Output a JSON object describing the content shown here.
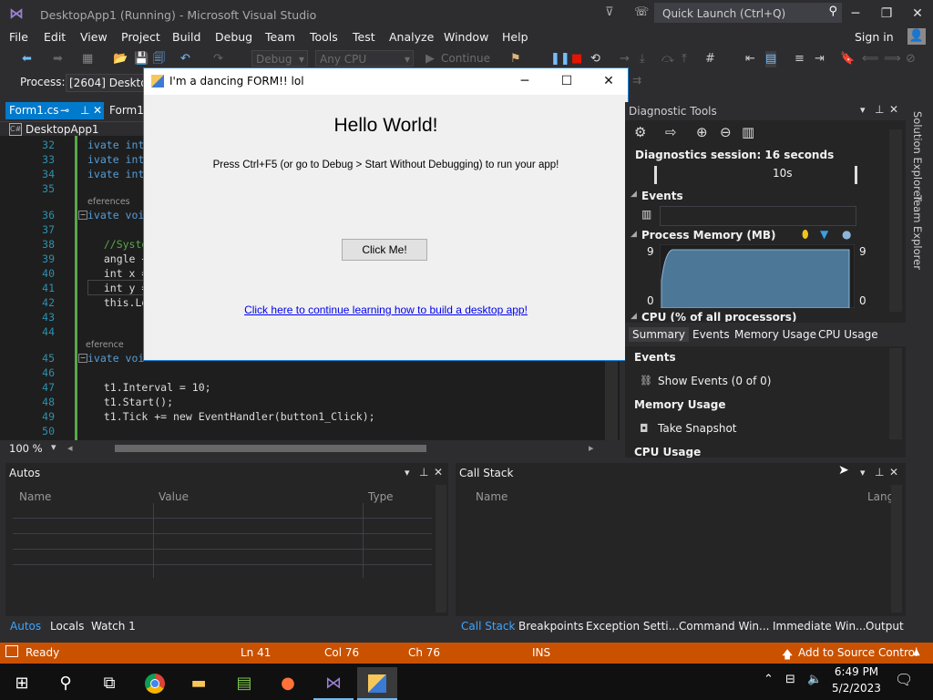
{
  "window": {
    "title": "DesktopApp1 (Running) - Microsoft Visual Studio",
    "quick_launch_placeholder": "Quick Launch (Ctrl+Q)",
    "minimize": "─",
    "maximize": "❐",
    "close": "✕"
  },
  "menu": [
    "File",
    "Edit",
    "View",
    "Project",
    "Build",
    "Debug",
    "Team",
    "Tools",
    "Test",
    "Analyze",
    "Window",
    "Help"
  ],
  "signin": "Sign in",
  "toolbar": {
    "config": "Debug",
    "platform": "Any CPU",
    "continue": "Continue"
  },
  "process": {
    "label": "Process:",
    "value": "[2604] Desktop"
  },
  "doctabs": [
    {
      "label": "Form1.cs"
    },
    {
      "label": "Form1."
    }
  ],
  "breadcrumb": "DesktopApp1",
  "code_lines": [
    {
      "n": "32",
      "text": "ivate int"
    },
    {
      "n": "33",
      "text": "ivate int"
    },
    {
      "n": "34",
      "text": "ivate int"
    },
    {
      "n": "35",
      "text": ""
    },
    {
      "n": "36",
      "text": "ivate voi"
    },
    {
      "n": "37",
      "text": ""
    },
    {
      "n": "38",
      "text": "  //Syste"
    },
    {
      "n": "39",
      "text": "  angle +"
    },
    {
      "n": "40",
      "text": "  int x ="
    },
    {
      "n": "41",
      "text": "  int y ="
    },
    {
      "n": "42",
      "text": "  this.Lo"
    },
    {
      "n": "43",
      "text": ""
    },
    {
      "n": "44",
      "text": ""
    },
    {
      "n": "45",
      "text": "ivate voi"
    },
    {
      "n": "46",
      "text": ""
    },
    {
      "n": "47",
      "text": "  t1.Interval = 10;"
    },
    {
      "n": "48",
      "text": "  t1.Start();"
    },
    {
      "n": "49",
      "text": "  t1.Tick += new EventHandler(button1_Click);"
    },
    {
      "n": "50",
      "text": ""
    }
  ],
  "refs": [
    "eferences",
    "eference"
  ],
  "zoom": "100 %",
  "dialog": {
    "title": "I'm a dancing FORM!! lol",
    "heading": "Hello World!",
    "instructions": "Press Ctrl+F5 (or go to Debug > Start Without Debugging) to run your app!",
    "button": "Click Me!",
    "link": "Click here to continue learning how to build a desktop app!"
  },
  "diagnostic": {
    "title": "Diagnostic Tools",
    "session": "Diagnostics session: 16 seconds",
    "tick": "10s",
    "events_header": "Events",
    "memory_header": "Process Memory (MB)",
    "mem_max_left": "9",
    "mem_min_left": "0",
    "mem_max_right": "9",
    "mem_min_right": "0",
    "cpu_header": "CPU (% of all processors)",
    "tabs": [
      "Summary",
      "Events",
      "Memory Usage",
      "CPU Usage"
    ],
    "events_section": "Events",
    "show_events": "Show Events (0 of 0)",
    "memory_section": "Memory Usage",
    "snapshot": "Take Snapshot",
    "cpu_section": "CPU Usage"
  },
  "side_labels": [
    "Solution Explorer",
    "Team Explorer"
  ],
  "autos": {
    "title": "Autos",
    "cols": [
      "Name",
      "Value",
      "Type"
    ]
  },
  "callstack": {
    "title": "Call Stack",
    "cols": [
      "Name",
      "Lang"
    ]
  },
  "bottom_tabs_left": [
    "Autos",
    "Locals",
    "Watch 1"
  ],
  "bottom_tabs_right": [
    "Call Stack",
    "Breakpoints",
    "Exception Setti...",
    "Command Win...",
    "Immediate Win...",
    "Output"
  ],
  "status": {
    "ready": "Ready",
    "ln": "Ln 41",
    "col": "Col 76",
    "ch": "Ch 76",
    "ins": "INS",
    "source_control": "Add to Source Control"
  },
  "clock": {
    "time": "6:49 PM",
    "date": "5/2/2023"
  },
  "colors": {
    "accent": "#007acc",
    "status": "#ca5100",
    "bg": "#2d2d30",
    "editor": "#1e1e1e"
  }
}
